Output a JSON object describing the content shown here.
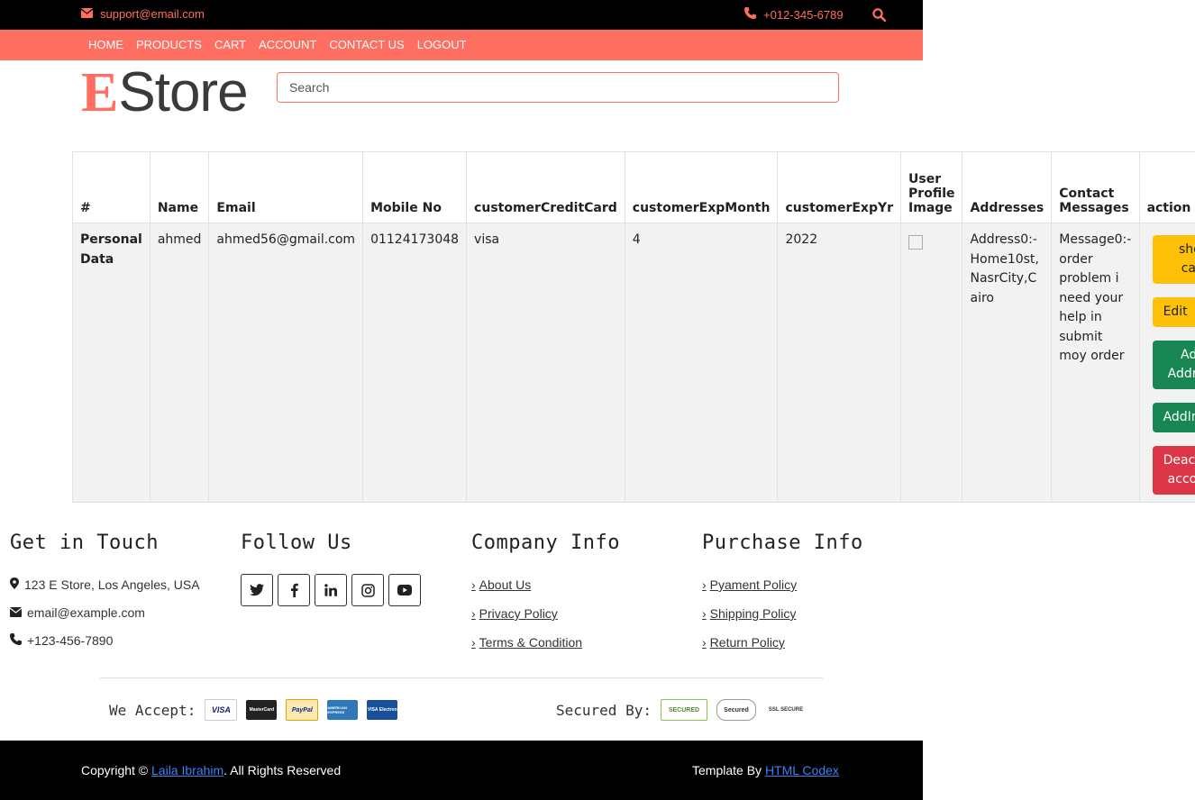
{
  "topbar": {
    "email": "support@email.com",
    "phone": "+012-345-6789",
    "search_icon": "search-icon"
  },
  "nav": {
    "items": [
      "HOME",
      "PRODUCTS",
      "CART",
      "ACCOUNT",
      "CONTACT US",
      "LOGOUT"
    ]
  },
  "logo": {
    "first": "E",
    "rest": "Store"
  },
  "search": {
    "placeholder": "Search"
  },
  "table": {
    "headers": [
      "#",
      "Name",
      "Email",
      "Mobile No",
      "customerCreditCard",
      "customerExpMonth",
      "customerExpYr",
      "User Profile Image",
      "Addresses",
      "Contact Messages",
      "action"
    ],
    "row": {
      "label": "Personal Data",
      "name": "ahmed",
      "email": "ahmed56@gmail.com",
      "mobile": "01124173048",
      "credit_card": "visa",
      "exp_month": "4",
      "exp_year": "2022",
      "address": "Address0:-Home10st,NasrCity,Cairo",
      "message": "Message0:-order problem i need your help in submit moy order"
    },
    "actions": {
      "show_card": "show card",
      "edit": "Edit",
      "add_address": "Add Address",
      "add_image": "AddImage",
      "deactivate": "Deactivate account"
    }
  },
  "footer": {
    "get_in_touch": {
      "title": "Get in Touch",
      "address": "123 E Store, Los Angeles, USA",
      "email": "email@example.com",
      "phone": "+123-456-7890"
    },
    "follow_us": {
      "title": "Follow Us",
      "icons": [
        "twitter-icon",
        "facebook-icon",
        "linkedin-icon",
        "instagram-icon",
        "youtube-icon"
      ]
    },
    "company_info": {
      "title": "Company Info",
      "links": [
        "About Us",
        "Privacy Policy",
        "Terms & Condition"
      ]
    },
    "purchase_info": {
      "title": "Purchase Info",
      "links": [
        "Pyament Policy",
        "Shipping Policy",
        "Return Policy"
      ]
    },
    "we_accept": "We Accept:",
    "cards": [
      "VISA",
      "MasterCard",
      "PayPal",
      "AMERICAN EXPRESS",
      "VISA Electron"
    ],
    "secured_by": "Secured By:",
    "badges": [
      "SECURED",
      "Secured",
      "SSL SECURE"
    ]
  },
  "bottom": {
    "copyright_prefix": "Copyright ©",
    "author": "Laila Ibrahim",
    "rights": ". All Rights Reserved",
    "template_by": "Template By",
    "template_link": "HTML Codex"
  },
  "colors": {
    "accent": "#ff6f61",
    "warning": "#ffc107",
    "success": "#198754",
    "danger": "#dc3545"
  }
}
